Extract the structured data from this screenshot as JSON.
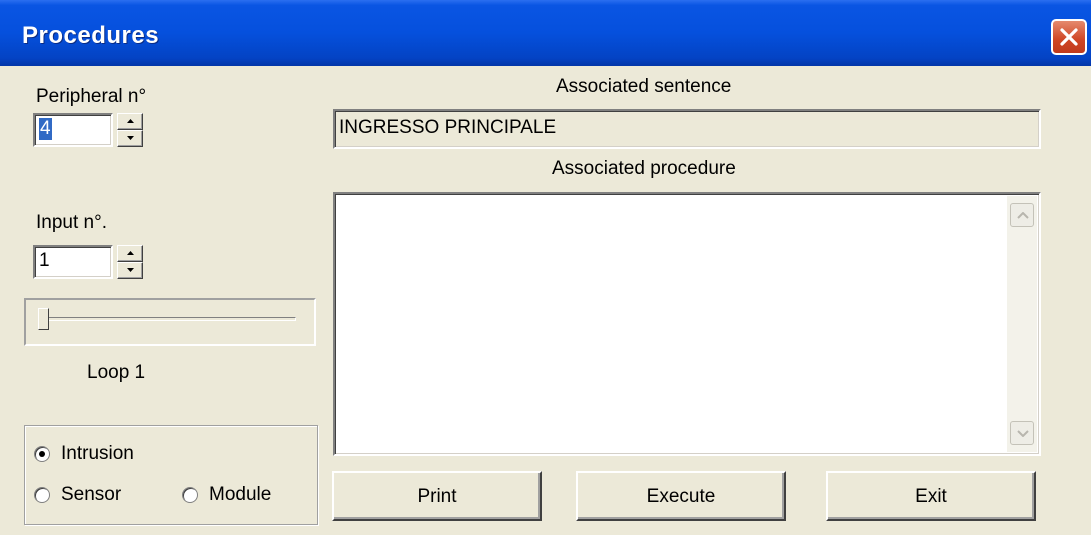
{
  "window": {
    "title": "Procedures"
  },
  "peripheral": {
    "label": "Peripheral n°",
    "value": "4"
  },
  "input": {
    "label": "Input n°.",
    "value": "1"
  },
  "loop": {
    "label": "Loop  1",
    "position": 0
  },
  "mode": {
    "options": [
      "Intrusion",
      "Sensor",
      "Module"
    ],
    "selected": "Intrusion"
  },
  "sentence": {
    "label": "Associated sentence",
    "value": "INGRESSO PRINCIPALE"
  },
  "procedure": {
    "label": "Associated procedure",
    "value": ""
  },
  "buttons": {
    "print": "Print",
    "execute": "Execute",
    "exit": "Exit"
  },
  "colors": {
    "titlebar": "#0550dd",
    "selection": "#316ac5",
    "face": "#ece9d8",
    "close": "#cf4524"
  },
  "icons": [
    "close-icon",
    "spin-up-icon",
    "spin-down-icon",
    "scroll-up-icon",
    "scroll-down-icon"
  ]
}
